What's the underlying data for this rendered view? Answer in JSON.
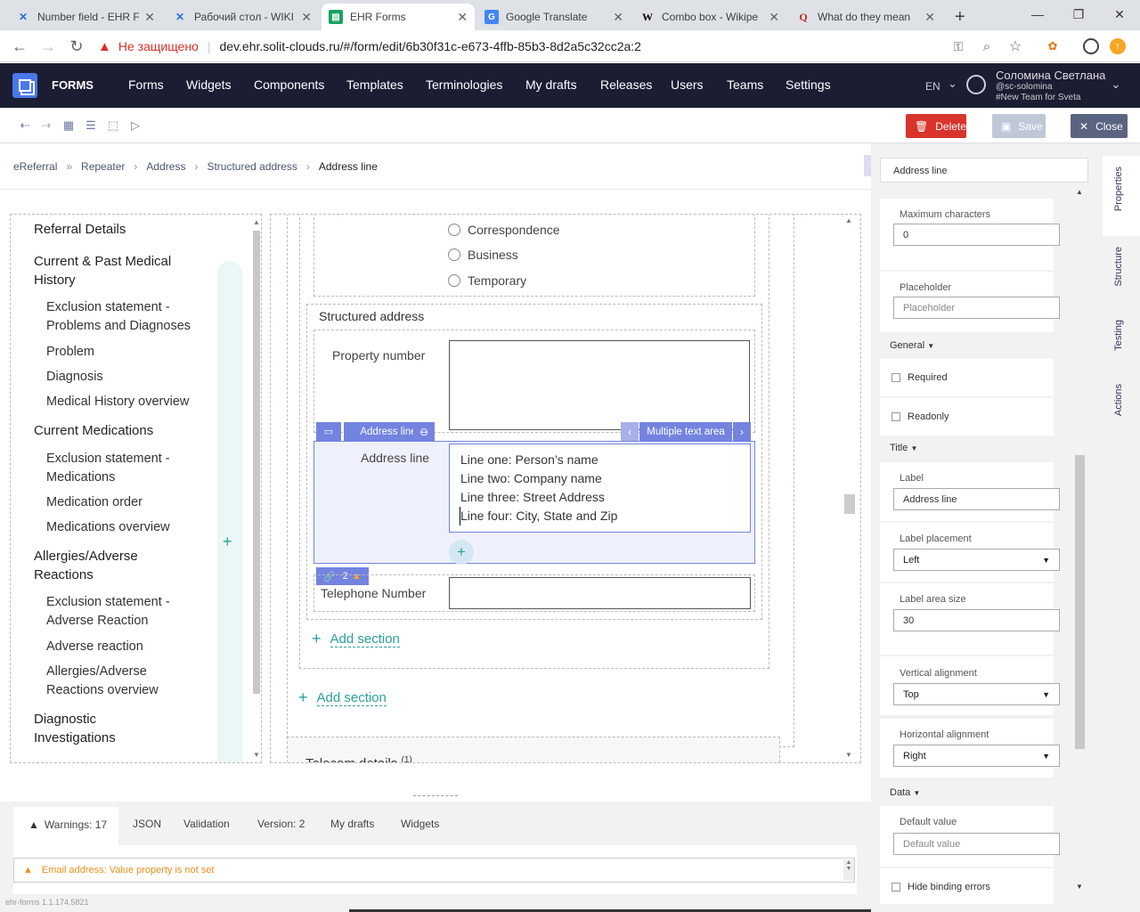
{
  "browser": {
    "tabs": [
      {
        "title": "Number field - EHR F",
        "icon": "confluence-icon"
      },
      {
        "title": "Рабочий стол - WIKI",
        "icon": "confluence-icon"
      },
      {
        "title": "EHR Forms",
        "icon": "ehr-forms-icon"
      },
      {
        "title": "Google Translate",
        "icon": "google-translate-icon"
      },
      {
        "title": "Combo box - Wikipe",
        "icon": "wikipedia-icon"
      },
      {
        "title": "What do they mean",
        "icon": "quora-icon"
      }
    ],
    "insecure_label": "Не защищено",
    "url": "dev.ehr.solit-clouds.ru/#/form/edit/6b30f31c-e673-4ffb-85b3-8d2a5c32cc2a:2"
  },
  "app": {
    "brand": "FORMS",
    "nav": [
      "Forms",
      "Widgets",
      "Components",
      "Templates",
      "Terminologies",
      "My drafts",
      "Releases",
      "Users",
      "Teams",
      "Settings"
    ],
    "lang": "EN",
    "user_name": "Соломина Светлана",
    "user_handle": "@sc-solomina",
    "user_team": "#New Team for Sveta"
  },
  "toolbar": {
    "delete": "Delete",
    "save": "Save",
    "close": "Close"
  },
  "breadcrumb": [
    "eReferral",
    "Repeater",
    "Address",
    "Structured address",
    "Address line"
  ],
  "nav_panel": {
    "items": [
      {
        "text": "Referral Details",
        "level": 1
      },
      {
        "text": "Current & Past Medical History",
        "level": 1
      },
      {
        "text": "Exclusion statement - Problems and Diagnoses",
        "level": 2
      },
      {
        "text": "Problem",
        "level": 2
      },
      {
        "text": "Diagnosis",
        "level": 2
      },
      {
        "text": "Medical History overview",
        "level": 2
      },
      {
        "text": "Current Medications",
        "level": 1
      },
      {
        "text": "Exclusion statement - Medications",
        "level": 2
      },
      {
        "text": "Medication order",
        "level": 2
      },
      {
        "text": "Medications overview",
        "level": 2
      },
      {
        "text": "Allergies/Adverse Reactions",
        "level": 1
      },
      {
        "text": "Exclusion statement - Adverse Reaction",
        "level": 2
      },
      {
        "text": "Adverse reaction",
        "level": 2
      },
      {
        "text": "Allergies/Adverse Reactions overview",
        "level": 2
      },
      {
        "text": "Diagnostic Investigations",
        "level": 1
      }
    ],
    "add_symbol": "+"
  },
  "form": {
    "radios": [
      "Correspondence",
      "Business",
      "Temporary"
    ],
    "structured_title": "Structured address",
    "property_label": "Property number",
    "address_label": "Address line",
    "address_lines": [
      "Line one: Person’s name",
      "Line two: Company name",
      "Line three: Street Address",
      "Line four: City, State and Zip"
    ],
    "chip_label": "Address line",
    "chip_type": "Multiple text area",
    "telephone_label": "Telephone Number",
    "binding_count": "2",
    "add_section": "Add section",
    "telecom": "Telecom details",
    "telecom_count": "(1)"
  },
  "props": {
    "name": "Address line",
    "tabs": [
      "Properties",
      "Structure",
      "Testing",
      "Actions"
    ],
    "max_chars_label": "Maximum characters",
    "max_chars": "0",
    "placeholder_label": "Placeholder",
    "placeholder_ph": "Placeholder",
    "general": "General",
    "required": "Required",
    "readonly": "Readonly",
    "title": "Title",
    "label_label": "Label",
    "label_value": "Address line",
    "placement_label": "Label placement",
    "placement_value": "Left",
    "area_label": "Label area size",
    "area_value": "30",
    "valign_label": "Vertical alignment",
    "valign_value": "Top",
    "halign_label": "Horizontal alignment",
    "halign_value": "Right",
    "data": "Data",
    "default_label": "Default value",
    "default_ph": "Default value",
    "hide_errors": "Hide binding errors"
  },
  "bottom": {
    "tabs": [
      "Warnings: 17",
      "JSON",
      "Validation",
      "Version: 2",
      "My drafts",
      "Widgets"
    ],
    "warning": "Email address: Value property is not set",
    "version": "ehr-forms 1.1.174.5821"
  },
  "colors": {
    "nav_bg": "#1b1d33",
    "accent": "#7383e0",
    "delete": "#d9342b",
    "close": "#5a6480",
    "teal": "#2aa198",
    "warning": "#e8901c"
  }
}
